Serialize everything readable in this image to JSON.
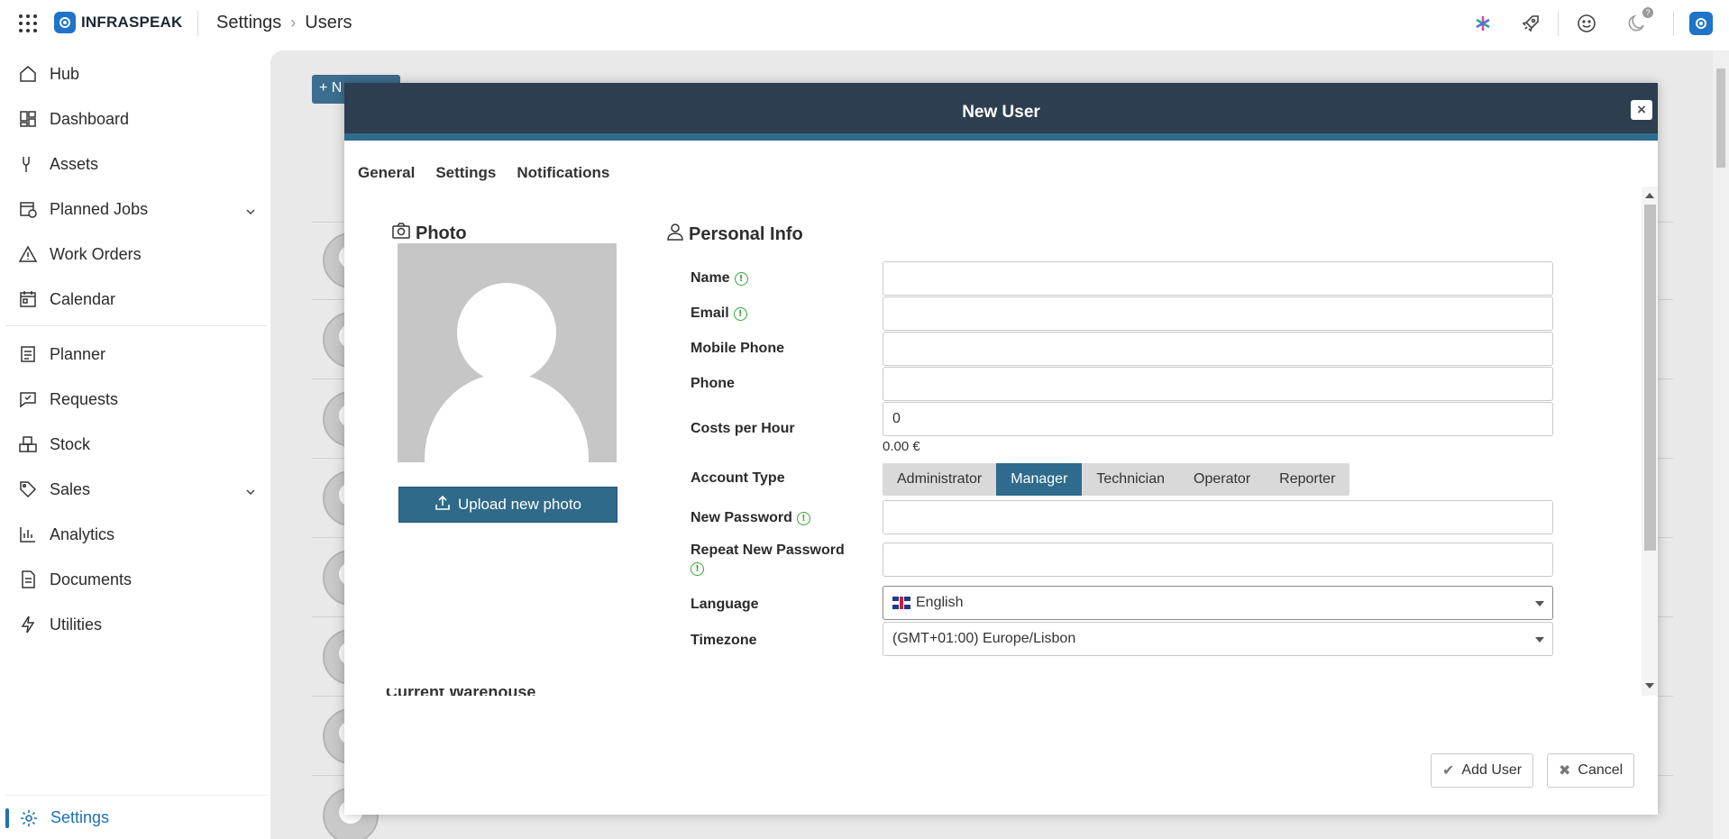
{
  "app": {
    "logo_text": "INFRASPEAK"
  },
  "breadcrumb": {
    "parent": "Settings",
    "current": "Users"
  },
  "top_icons": [
    "sparkle-icon",
    "rocket-icon",
    "smiley-icon",
    "moon-icon",
    "avatar-icon"
  ],
  "help_badge": "?",
  "sidebar": {
    "items": [
      {
        "label": "Hub",
        "icon": "home-icon"
      },
      {
        "label": "Dashboard",
        "icon": "dashboard-icon"
      },
      {
        "label": "Assets",
        "icon": "wrench-icon"
      },
      {
        "label": "Planned Jobs",
        "icon": "calendar-clock-icon",
        "expandable": true
      },
      {
        "label": "Work Orders",
        "icon": "warning-icon"
      },
      {
        "label": "Calendar",
        "icon": "calendar-icon"
      },
      {
        "label": "Planner",
        "icon": "planner-icon"
      },
      {
        "label": "Requests",
        "icon": "request-icon"
      },
      {
        "label": "Stock",
        "icon": "boxes-icon"
      },
      {
        "label": "Sales",
        "icon": "tag-icon",
        "expandable": true
      },
      {
        "label": "Analytics",
        "icon": "chart-icon"
      },
      {
        "label": "Documents",
        "icon": "document-icon"
      },
      {
        "label": "Utilities",
        "icon": "bolt-icon"
      }
    ],
    "active": {
      "label": "Settings",
      "icon": "gear-icon"
    }
  },
  "background": {
    "new_button": "+ N"
  },
  "modal": {
    "title": "New User",
    "tabs": [
      "General",
      "Settings",
      "Notifications"
    ],
    "photo": {
      "title": "Photo",
      "upload_label": "Upload new photo"
    },
    "personal": {
      "title": "Personal Info",
      "name_label": "Name",
      "email_label": "Email",
      "mobile_label": "Mobile Phone",
      "phone_label": "Phone",
      "cost_label": "Costs per Hour",
      "cost_value": "0",
      "cost_formatted": "0.00 €",
      "account_type_label": "Account Type",
      "account_types": [
        "Administrator",
        "Manager",
        "Technician",
        "Operator",
        "Reporter"
      ],
      "account_type_selected": "Manager",
      "new_password_label": "New Password",
      "repeat_password_label": "Repeat New Password",
      "language_label": "Language",
      "language_value": "English",
      "timezone_label": "Timezone",
      "timezone_value": "(GMT+01:00) Europe/Lisbon"
    },
    "next_section": "Current Warehouse",
    "add_button": "Add User",
    "cancel_button": "Cancel"
  }
}
